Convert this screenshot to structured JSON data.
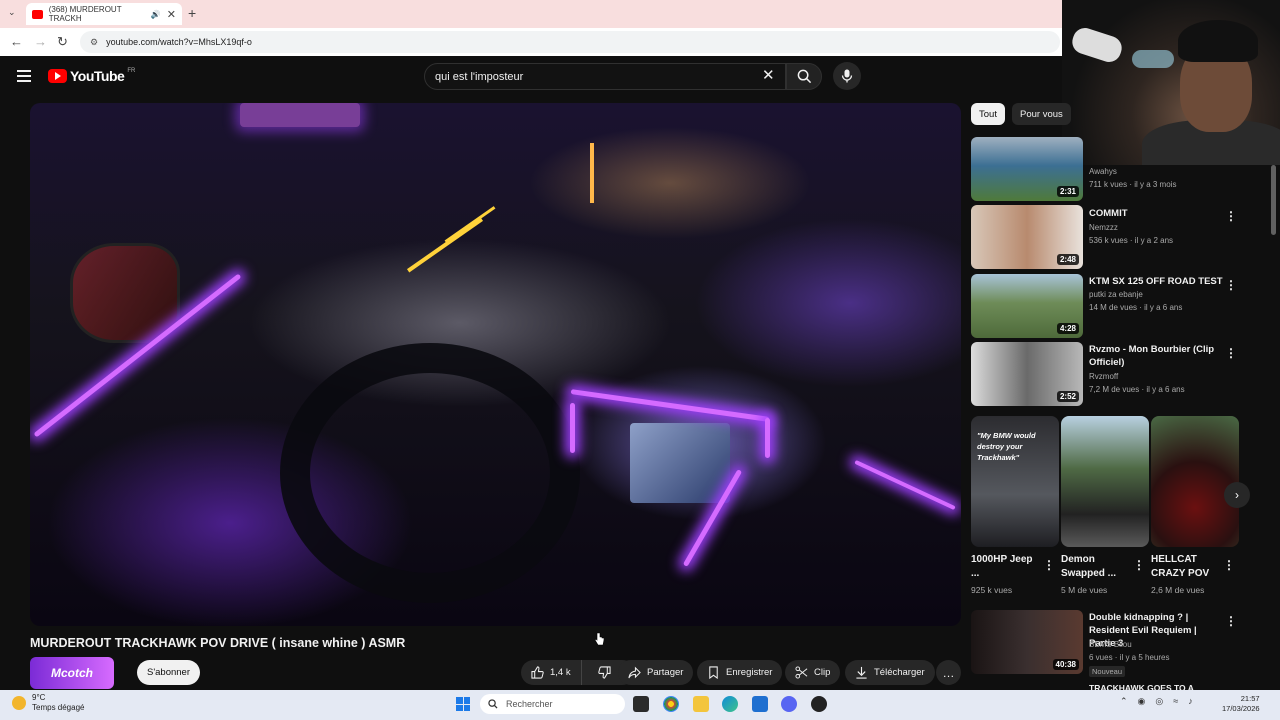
{
  "browser": {
    "tab_title": "(368) MURDEROUT TRACKH",
    "url": "youtube.com/watch?v=MhsLX19qf-o"
  },
  "header": {
    "logo_text": "YouTube",
    "country": "FR",
    "search_query": "qui est l'imposteur"
  },
  "video": {
    "title": "MURDEROUT TRACKHAWK POV DRIVE ( insane whine ) ASMR",
    "channel_logo_text": "Mcotch",
    "subscribe_label": "S'abonner",
    "likes": "1,4 k",
    "share_label": "Partager",
    "save_label": "Enregistrer",
    "clip_label": "Clip",
    "download_label": "Télécharger"
  },
  "sidebar": {
    "chips": [
      "Tout",
      "Pour vous"
    ],
    "recommendations": [
      {
        "title": "",
        "channel": "Awahys",
        "meta": "711 k vues · il y a 3 mois",
        "duration": "2:31",
        "thumb": "#3c6f93"
      },
      {
        "title": "COMMIT",
        "channel": "Nemzzz",
        "meta": "536 k vues · il y a 2 ans",
        "duration": "2:48",
        "thumb": "#b88a6e"
      },
      {
        "title": "KTM SX 125  OFF ROAD TEST",
        "channel": "putki za ebanje",
        "meta": "14 M de vues · il y a 6 ans",
        "duration": "4:28",
        "thumb": "#6e8c58"
      },
      {
        "title": "Rvzmo - Mon Bourbier (Clip Officiel)",
        "channel": "Rvzmoff",
        "meta": "7,2 M de vues · il y a 6 ans",
        "duration": "2:52",
        "thumb": "#6a6a6a"
      },
      {
        "title": "Double kidnapping ? | Resident Evil Requiem | Partie 3",
        "channel": "BEMS Bilou",
        "meta": "6 vues · il y a 5 heures",
        "duration": "40:38",
        "badge": "Nouveau",
        "thumb": "#3a2f2f"
      }
    ],
    "shorts": [
      {
        "title": "1000HP Jeep ...",
        "views": "925 k vues",
        "overlay": "\"My BMW would destroy your Trackhawk\"",
        "thumb": "#2c2c30"
      },
      {
        "title": "Demon Swapped ...",
        "views": "5 M de vues",
        "thumb": "#4f6a45"
      },
      {
        "title": "HELLCAT CRAZY POV",
        "views": "2,6 M de vues",
        "thumb": "#4a2020"
      }
    ],
    "next_partial": "TRACKHAWK GOES TO A"
  },
  "taskbar": {
    "temp": "9°C",
    "weather": "Temps dégagé",
    "search_placeholder": "Rechercher",
    "time": "21:57",
    "date": "17/03/2026"
  },
  "colors": {
    "accent": "#ff0000",
    "neon": "#d56bff"
  }
}
